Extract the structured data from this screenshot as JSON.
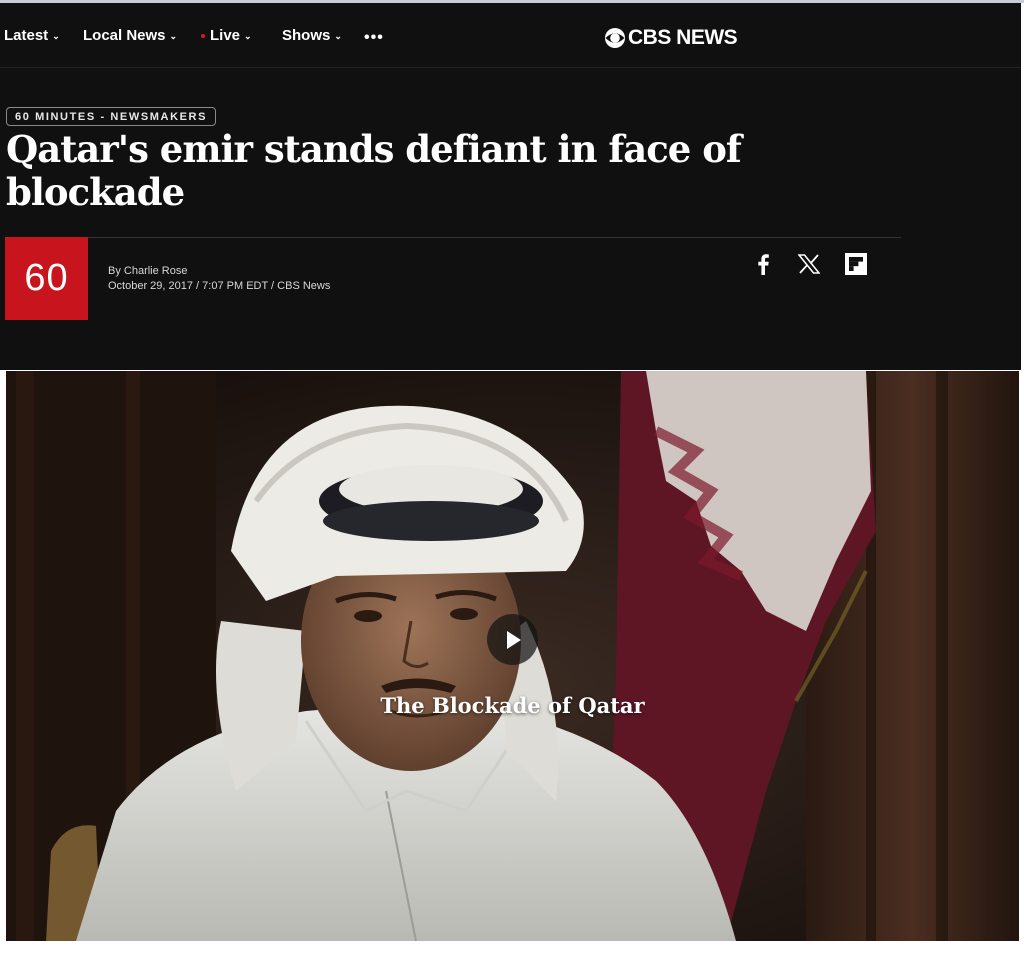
{
  "nav": {
    "items": [
      {
        "label": "Latest",
        "has_dropdown": true
      },
      {
        "label": "Local News",
        "has_dropdown": true
      },
      {
        "label": "Live",
        "has_dropdown": true,
        "live_indicator": true
      },
      {
        "label": "Shows",
        "has_dropdown": true
      }
    ],
    "more_icon": "ellipsis-icon",
    "brand": "CBS NEWS"
  },
  "article": {
    "kicker": "60 MINUTES - NEWSMAKERS",
    "headline": "Qatar's emir stands defiant in face of blockade",
    "show_logo": "60",
    "author": "By Charlie Rose",
    "dateline": "October 29, 2017 / 7:07 PM EDT / CBS News"
  },
  "share": {
    "icons": [
      "facebook-icon",
      "x-icon",
      "flipboard-icon"
    ]
  },
  "video": {
    "title": "The Blockade of Qatar",
    "play_icon": "play-icon"
  },
  "colors": {
    "header_bg": "#101010",
    "accent_red": "#c8141c",
    "live_dot": "#d11a2a",
    "text": "#ffffff"
  }
}
